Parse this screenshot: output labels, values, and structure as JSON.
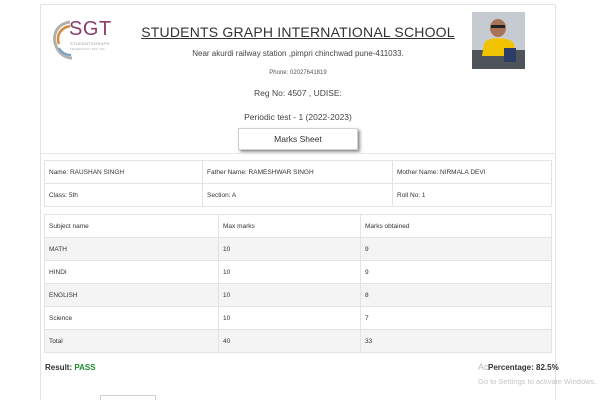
{
  "header": {
    "logo_text": "SGT",
    "logo_sub1": "STUDENTSGRAPH",
    "logo_sub2": "TECHNOLOGY PVT. LTD.",
    "school_name": "STUDENTS GRAPH INTERNATIONAL SCHOOL",
    "address": "Near akurdi railway station ,pimpri chinchwad pune-411033.",
    "phone": "Phone: 02027641819",
    "reg": "Reg No: 4507 , UDISE:",
    "exam": "Periodic test - 1 (2022-2023)",
    "marks_sheet_label": "Marks Sheet"
  },
  "student": {
    "name": "Name: RAUSHAN SINGH",
    "father": "Father Name: RAMESHWAR SINGH",
    "mother": "Mother Name: NIRMALA DEVI",
    "class": "Class: 5th",
    "section": "Section: A",
    "roll": "Roll No: 1"
  },
  "marks": {
    "columns": [
      "Subject name",
      "Max marks",
      "Marks obtained"
    ],
    "rows": [
      [
        "MATH",
        "10",
        "9"
      ],
      [
        "HINDI",
        "10",
        "9"
      ],
      [
        "ENGLISH",
        "10",
        "8"
      ],
      [
        "Science",
        "10",
        "7"
      ],
      [
        "Total",
        "40",
        "33"
      ]
    ]
  },
  "summary": {
    "result_label": "Result:",
    "result_value": "PASS",
    "percentage": "Percentage: 82.5%"
  },
  "watermark": {
    "line1": "Ac",
    "line2": "Go to Settings to activate Windows."
  },
  "colors": {
    "pass": "#1e8a2e",
    "logo": "#8a3f6b"
  }
}
